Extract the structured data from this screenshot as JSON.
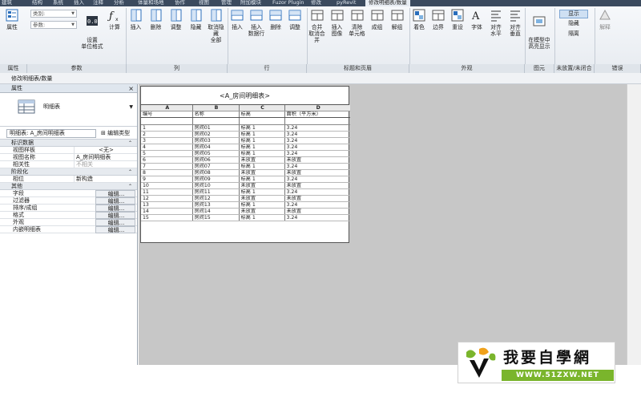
{
  "ribbon": {
    "tabs": [
      "建筑",
      "结构",
      "系统",
      "插入",
      "注释",
      "分析",
      "体量和场地",
      "协作",
      "视图",
      "管理",
      "附加模块",
      "Fuzor Plugin",
      "修改",
      "pyRevit",
      "修改明细表/数量"
    ],
    "active_tab": "修改明细表/数量",
    "props_button": "属性",
    "combos": {
      "category": "类别:",
      "params": "参数:"
    },
    "params_buttons": [
      "设置\n单位格式",
      "计算"
    ],
    "column_buttons": [
      "插入",
      "删除",
      "调整",
      "隐藏",
      "取消隐藏\n全部"
    ],
    "row_buttons": [
      "插入",
      "插入\n数据行",
      "删除",
      "调整"
    ],
    "titles_buttons": [
      "合并\n取消合并",
      "插入\n图像",
      "清除\n单元格",
      "成组",
      "解组"
    ],
    "appearance_buttons": [
      "着色",
      "边界",
      "重设",
      "字体",
      "对齐\n水平",
      "对齐\n垂直"
    ],
    "element_button": "在模型中\n高亮显示",
    "unplaced_buttons": [
      "显示",
      "隐藏",
      "隔离"
    ],
    "room_button": "解释",
    "panel_labels": [
      "属性",
      "参数",
      "列",
      "行",
      "标题和页眉",
      "外观",
      "图元",
      "未放置/未闭合",
      "错误"
    ]
  },
  "breadcrumb": "修改明细表/数量",
  "properties": {
    "header": "属性",
    "close": "×",
    "type_label": "明细表",
    "selector": "明细表: A_房间明细表",
    "edit_type": "编辑类型",
    "groups": [
      {
        "name": "标识数据",
        "rows": [
          {
            "key": "视图样板",
            "value": "<无>",
            "style": "center"
          },
          {
            "key": "视图名称",
            "value": "A_房间明细表",
            "style": ""
          },
          {
            "key": "相关性",
            "value": "不相关",
            "style": "gray"
          }
        ]
      },
      {
        "name": "阶段化",
        "rows": [
          {
            "key": "相位",
            "value": "新构造",
            "style": ""
          }
        ]
      },
      {
        "name": "其他",
        "rows": [
          {
            "key": "字段",
            "value": "编辑...",
            "style": "btn"
          },
          {
            "key": "过滤器",
            "value": "编辑...",
            "style": "btn"
          },
          {
            "key": "排序/成组",
            "value": "编辑...",
            "style": "btn"
          },
          {
            "key": "格式",
            "value": "编辑...",
            "style": "btn"
          },
          {
            "key": "外观",
            "value": "编辑...",
            "style": "btn"
          },
          {
            "key": "内嵌明细表",
            "value": "编辑...",
            "style": "btn"
          }
        ]
      }
    ]
  },
  "schedule": {
    "title": "<A_房间明细表>",
    "column_letters": [
      "A",
      "B",
      "C",
      "D"
    ],
    "column_headers": [
      "编号",
      "名称",
      "标高",
      "面积（平方米）"
    ],
    "rows": [
      [
        "1",
        "房间01",
        "标高 1",
        "3.24"
      ],
      [
        "2",
        "房间02",
        "标高 1",
        "3.24"
      ],
      [
        "3",
        "房间03",
        "标高 1",
        "3.24"
      ],
      [
        "4",
        "房间04",
        "标高 1",
        "3.24"
      ],
      [
        "5",
        "房间05",
        "标高 1",
        "3.24"
      ],
      [
        "6",
        "房间06",
        "未放置",
        "未放置"
      ],
      [
        "7",
        "房间07",
        "标高 1",
        "3.24"
      ],
      [
        "8",
        "房间08",
        "未放置",
        "未放置"
      ],
      [
        "9",
        "房间09",
        "标高 1",
        "3.24"
      ],
      [
        "10",
        "房间10",
        "未放置",
        "未放置"
      ],
      [
        "11",
        "房间11",
        "标高 1",
        "3.24"
      ],
      [
        "12",
        "房间12",
        "未放置",
        "未放置"
      ],
      [
        "13",
        "房间13",
        "标高 1",
        "3.24"
      ],
      [
        "14",
        "房间14",
        "未放置",
        "未放置"
      ],
      [
        "15",
        "房间15",
        "标高 1",
        "3.24"
      ]
    ]
  },
  "watermark": {
    "name": "我要自學網",
    "url": "WWW.51ZXW.NET"
  }
}
